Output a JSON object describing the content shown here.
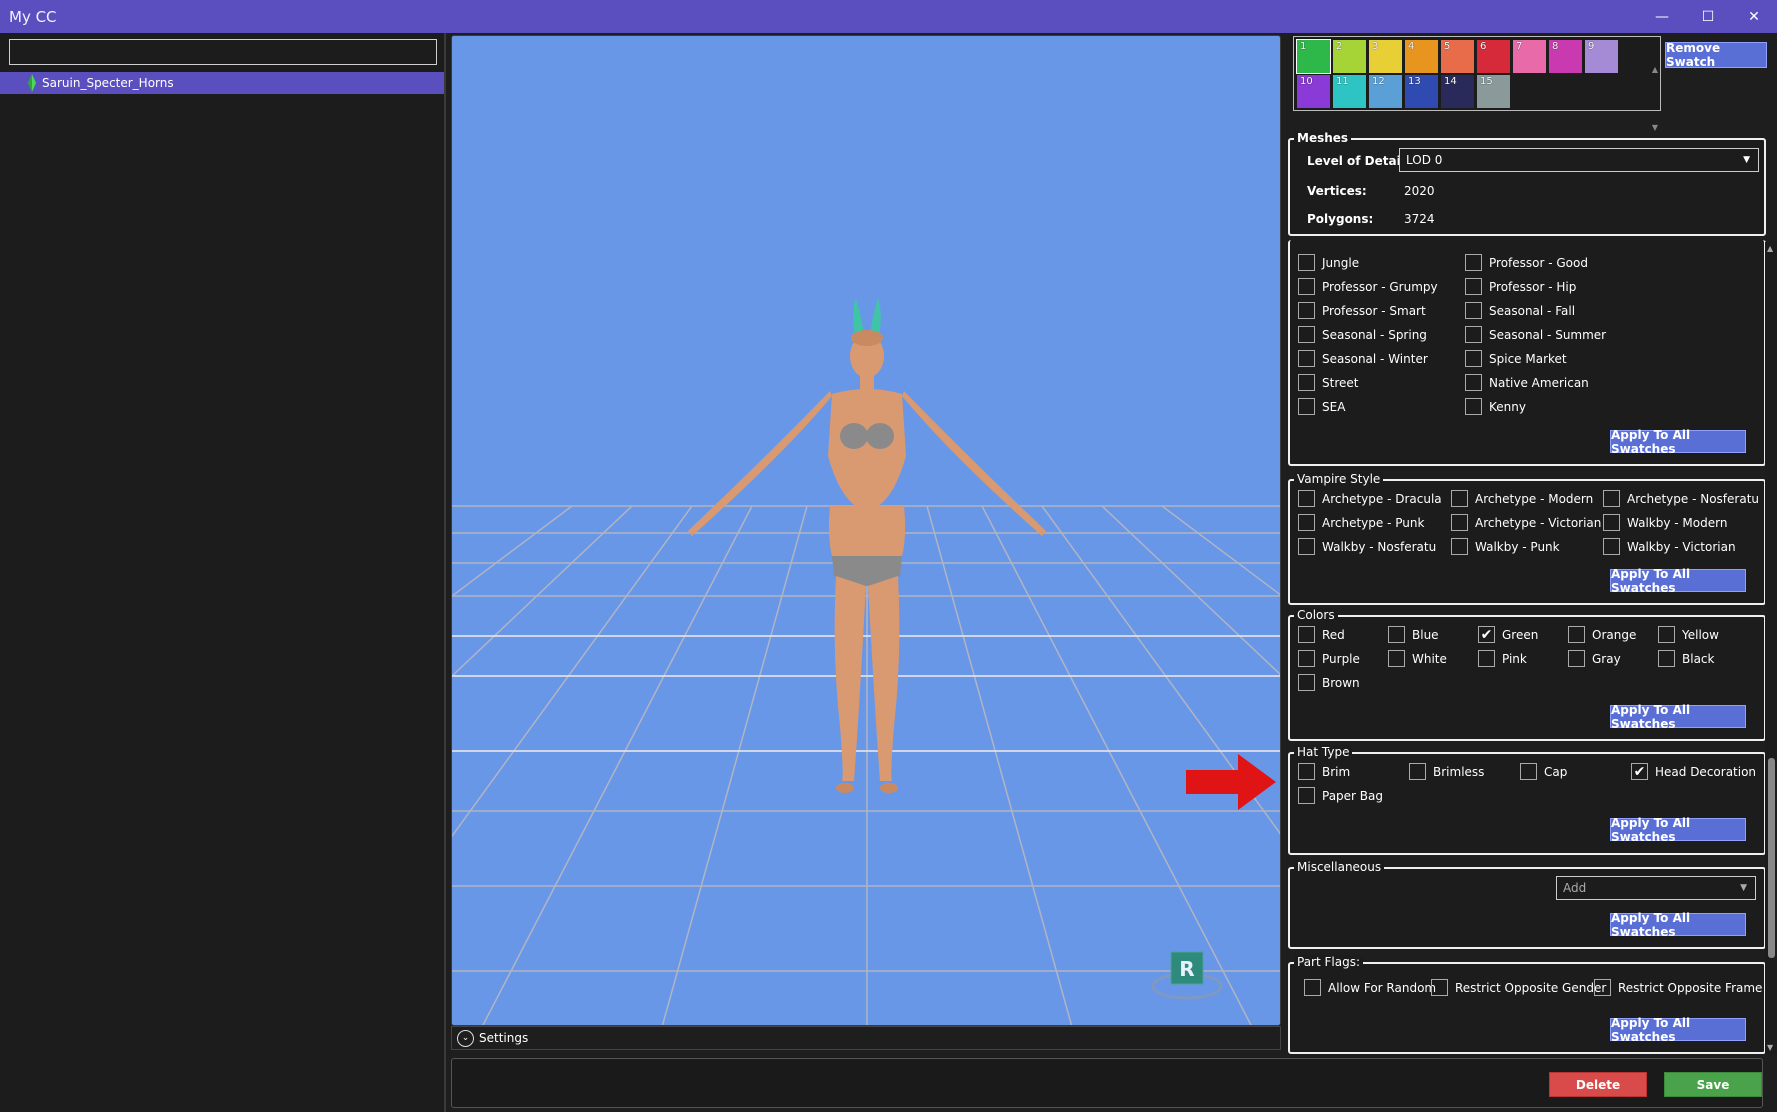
{
  "app": {
    "title": "My CC"
  },
  "window": {
    "minimize": "—",
    "maximize": "☐",
    "close": "✕"
  },
  "left_panel": {
    "search": {
      "value": "",
      "placeholder": ""
    },
    "tree": [
      {
        "label": "Saruin_Specter_Horns"
      }
    ]
  },
  "viewport": {
    "settings_label": "Settings",
    "badge": "R",
    "background": "#6997e8"
  },
  "swatches": {
    "items": [
      {
        "label": "1",
        "color": "#2fb84a"
      },
      {
        "label": "2",
        "color": "#a6d436"
      },
      {
        "label": "3",
        "color": "#e8cf35"
      },
      {
        "label": "4",
        "color": "#e8951f"
      },
      {
        "label": "5",
        "color": "#e86c4a"
      },
      {
        "label": "6",
        "color": "#d62a3a"
      },
      {
        "label": "7",
        "color": "#e86aa8"
      },
      {
        "label": "8",
        "color": "#c93ab0"
      },
      {
        "label": "9",
        "color": "#a58ad6"
      },
      {
        "label": "10",
        "color": "#8a3ad6"
      },
      {
        "label": "11",
        "color": "#2fc4c4"
      },
      {
        "label": "12",
        "color": "#5aa0d6"
      },
      {
        "label": "13",
        "color": "#2f4ab0"
      },
      {
        "label": "14",
        "color": "#2a2a5a"
      },
      {
        "label": "15",
        "color": "#8a9a9a"
      }
    ],
    "remove_label": "Remove Swatch"
  },
  "meshes": {
    "legend": "Meshes",
    "lod_label": "Level of Detail:",
    "lod_value": "LOD 0",
    "vertices_label": "Vertices:",
    "vertices_value": "2020",
    "polygons_label": "Polygons:",
    "polygons_value": "3724"
  },
  "style_panel": {
    "col1": [
      "Jungle",
      "Professor - Grumpy",
      "Professor - Smart",
      "Seasonal - Spring",
      "Seasonal - Winter",
      "Street",
      "SEA"
    ],
    "col2": [
      "Professor - Good",
      "Professor - Hip",
      "Seasonal - Fall",
      "Seasonal - Summer",
      "Spice Market",
      "Native American",
      "Kenny"
    ],
    "apply": "Apply To All Swatches"
  },
  "vampire": {
    "legend": "Vampire Style",
    "items": [
      "Archetype - Dracula",
      "Archetype - Modern",
      "Archetype - Nosferatu",
      "Archetype - Punk",
      "Archetype - Victorian",
      "Walkby - Modern",
      "Walkby - Nosferatu",
      "Walkby - Punk",
      "Walkby - Victorian"
    ],
    "apply": "Apply To All Swatches"
  },
  "colors": {
    "legend": "Colors",
    "items": [
      {
        "label": "Red",
        "checked": false
      },
      {
        "label": "Blue",
        "checked": false
      },
      {
        "label": "Green",
        "checked": true
      },
      {
        "label": "Orange",
        "checked": false
      },
      {
        "label": "Yellow",
        "checked": false
      },
      {
        "label": "Purple",
        "checked": false
      },
      {
        "label": "White",
        "checked": false
      },
      {
        "label": "Pink",
        "checked": false
      },
      {
        "label": "Gray",
        "checked": false
      },
      {
        "label": "Black",
        "checked": false
      },
      {
        "label": "Brown",
        "checked": false
      }
    ],
    "apply": "Apply To All Swatches"
  },
  "hat_type": {
    "legend": "Hat Type",
    "items": [
      {
        "label": "Brim",
        "checked": false
      },
      {
        "label": "Brimless",
        "checked": false
      },
      {
        "label": "Cap",
        "checked": false
      },
      {
        "label": "Head Decoration",
        "checked": true
      },
      {
        "label": "Paper Bag",
        "checked": false
      }
    ],
    "apply": "Apply To All Swatches"
  },
  "misc": {
    "legend": "Miscellaneous",
    "dropdown": "Add",
    "apply": "Apply To All Swatches"
  },
  "part_flags": {
    "legend": "Part Flags:",
    "items": [
      "Allow For Random",
      "Restrict Opposite Gender",
      "Restrict Opposite Frame"
    ],
    "apply": "Apply To All Swatches"
  },
  "footer": {
    "delete": "Delete",
    "save": "Save"
  }
}
